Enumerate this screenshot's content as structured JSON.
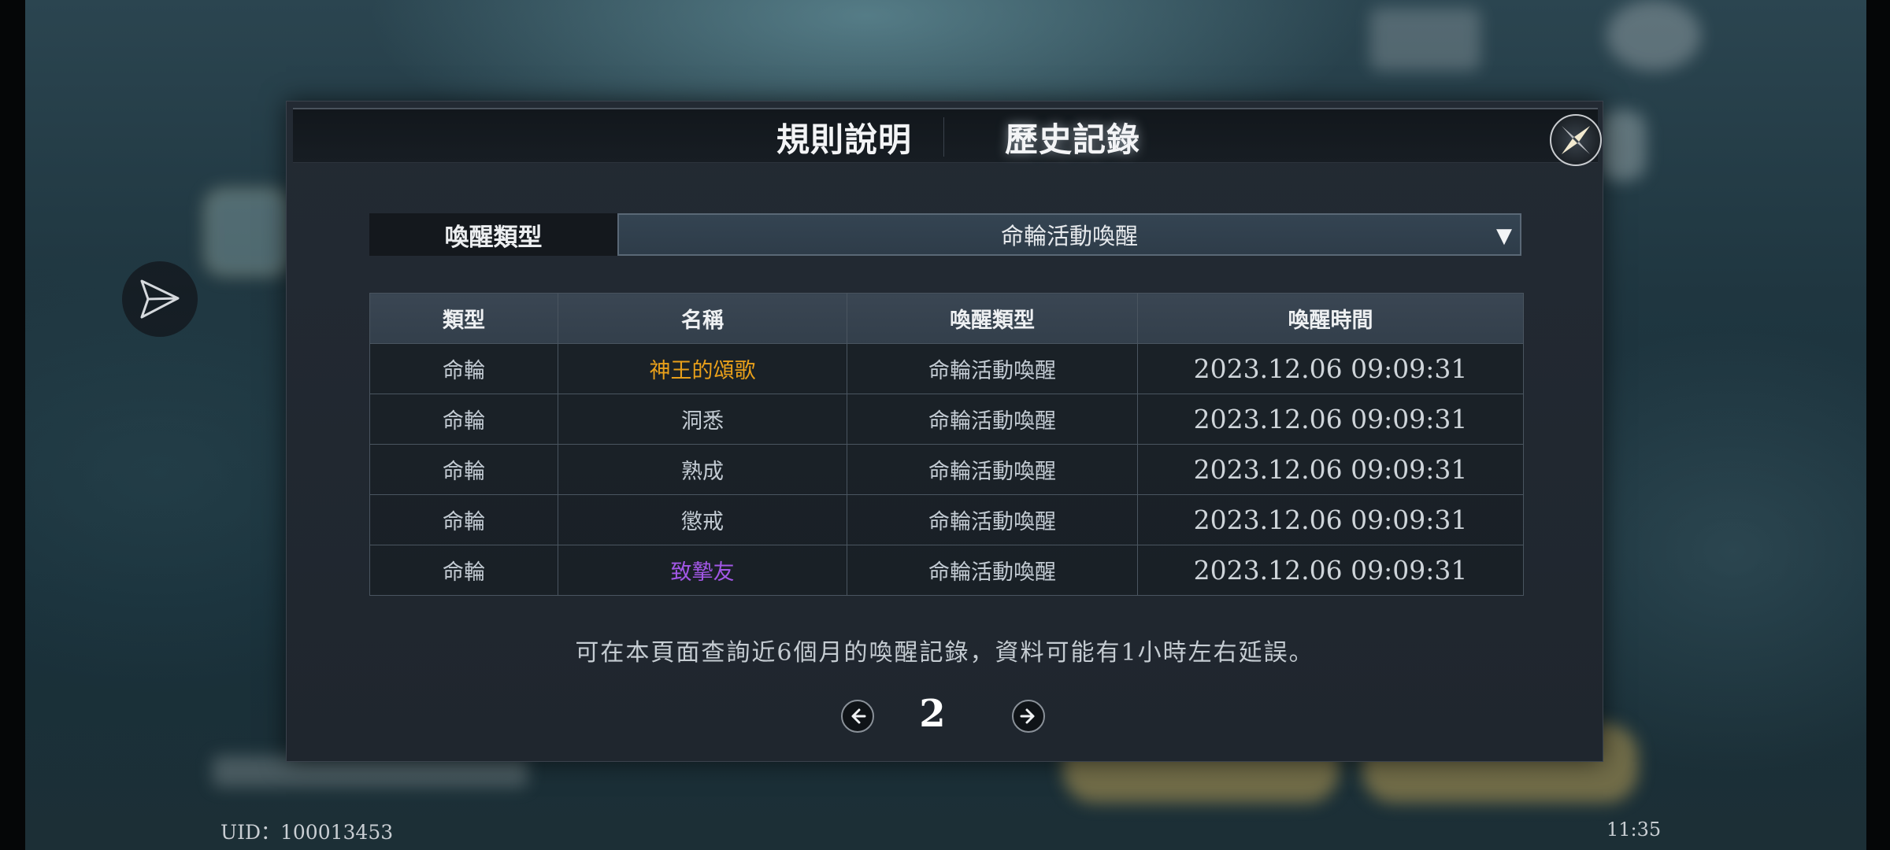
{
  "tabs": {
    "rules_label": "規則說明",
    "history_label": "歷史記錄",
    "active": "history"
  },
  "filter": {
    "label": "喚醒類型",
    "selected": "命輪活動喚醒",
    "arrow": "▼"
  },
  "table": {
    "headers": [
      "類型",
      "名稱",
      "喚醒類型",
      "喚醒時間"
    ],
    "rows": [
      {
        "type": "命輪",
        "name": "神王的頌歌",
        "wake_type": "命輪活動喚醒",
        "time": "2023.12.06 09:09:31",
        "name_color": "#e9a01a"
      },
      {
        "type": "命輪",
        "name": "洞悉",
        "wake_type": "命輪活動喚醒",
        "time": "2023.12.06 09:09:31",
        "name_color": "#c3cbd3"
      },
      {
        "type": "命輪",
        "name": "熟成",
        "wake_type": "命輪活動喚醒",
        "time": "2023.12.06 09:09:31",
        "name_color": "#c3cbd3"
      },
      {
        "type": "命輪",
        "name": "懲戒",
        "wake_type": "命輪活動喚醒",
        "time": "2023.12.06 09:09:31",
        "name_color": "#c3cbd3"
      },
      {
        "type": "命輪",
        "name": "致摯友",
        "wake_type": "命輪活動喚醒",
        "time": "2023.12.06 09:09:31",
        "name_color": "#a257e6"
      }
    ]
  },
  "notice": "可在本頁面查詢近6個月的喚醒記錄，資料可能有1小時左右延誤。",
  "pagination": {
    "current_page": "2",
    "prev_icon": "arrow-left-icon",
    "next_icon": "arrow-right-icon"
  },
  "footer": {
    "uid": "UID：100013453",
    "clock": "11:35"
  },
  "icons": {
    "share": "paper-plane-icon",
    "close": "close-compass-icon"
  }
}
